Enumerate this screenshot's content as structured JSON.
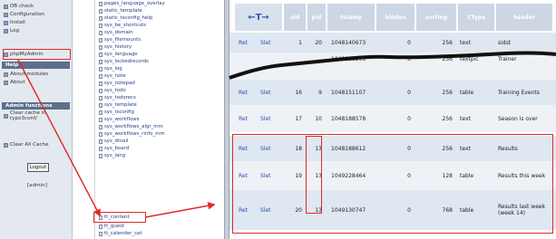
{
  "left": {
    "items_top": [
      {
        "label": "DB check"
      },
      {
        "label": "Configuration"
      },
      {
        "label": "Install"
      },
      {
        "label": "Log"
      },
      {
        "label": "phpMyAdmin"
      }
    ],
    "help_section": "Help",
    "help_items": [
      {
        "label": "About modules"
      },
      {
        "label": "About"
      }
    ],
    "admin_section": "Admin functions",
    "admin_items": [
      {
        "label": "Clear cache in typo3conf/"
      },
      {
        "label": "Clear All Cache"
      }
    ],
    "login_button": "Logout",
    "user": "[admin]"
  },
  "middle": {
    "tables": [
      "pages_language_overlay",
      "static_template",
      "static_tsconfig_help",
      "sys_be_shortcuts",
      "sys_domain",
      "sys_filemounts",
      "sys_history",
      "sys_language",
      "sys_lockedrecords",
      "sys_log",
      "sys_note",
      "sys_notepad",
      "sys_todo",
      "sys_todorecs",
      "sys_template",
      "sys_tsconfig",
      "sys_workflows",
      "sys_workflows_algr_mm",
      "sys_workflows_rinfo_mm",
      "sys_dmail",
      "sys_board",
      "sys_lang",
      "tt_content",
      "tt_guest",
      "tt_calender_cat"
    ],
    "highlighted_table": "tt_content"
  },
  "right": {
    "arrow_symbol": "←T→",
    "columns": [
      "uid",
      "pid",
      "tstamp",
      "hidden",
      "sorting",
      "CType",
      "header"
    ],
    "row_actions": {
      "edit": "Ret",
      "delete": "Slet"
    },
    "rows": [
      {
        "uid": "1",
        "pid": "20",
        "tstamp": "1048140673",
        "hidden": "0",
        "sorting": "256",
        "ctype": "text",
        "header": "sidst"
      },
      {
        "uid": "",
        "pid": "",
        "tstamp": "1048185293",
        "hidden": "0",
        "sorting": "256",
        "ctype": "textpic",
        "header": "Trainer"
      },
      {
        "uid": "16",
        "pid": "9",
        "tstamp": "1048151107",
        "hidden": "0",
        "sorting": "256",
        "ctype": "table",
        "header": "Training Events"
      },
      {
        "uid": "17",
        "pid": "10",
        "tstamp": "1048188578",
        "hidden": "0",
        "sorting": "256",
        "ctype": "text",
        "header": "Season is over"
      },
      {
        "uid": "18",
        "pid": "13",
        "tstamp": "1048188612",
        "hidden": "0",
        "sorting": "256",
        "ctype": "text",
        "header": "Results"
      },
      {
        "uid": "19",
        "pid": "13",
        "tstamp": "1049228464",
        "hidden": "0",
        "sorting": "128",
        "ctype": "table",
        "header": "Results this week"
      },
      {
        "uid": "20",
        "pid": "13",
        "tstamp": "1049130747",
        "hidden": "0",
        "sorting": "768",
        "ctype": "table",
        "header": "Results last week (week 14)"
      }
    ]
  }
}
